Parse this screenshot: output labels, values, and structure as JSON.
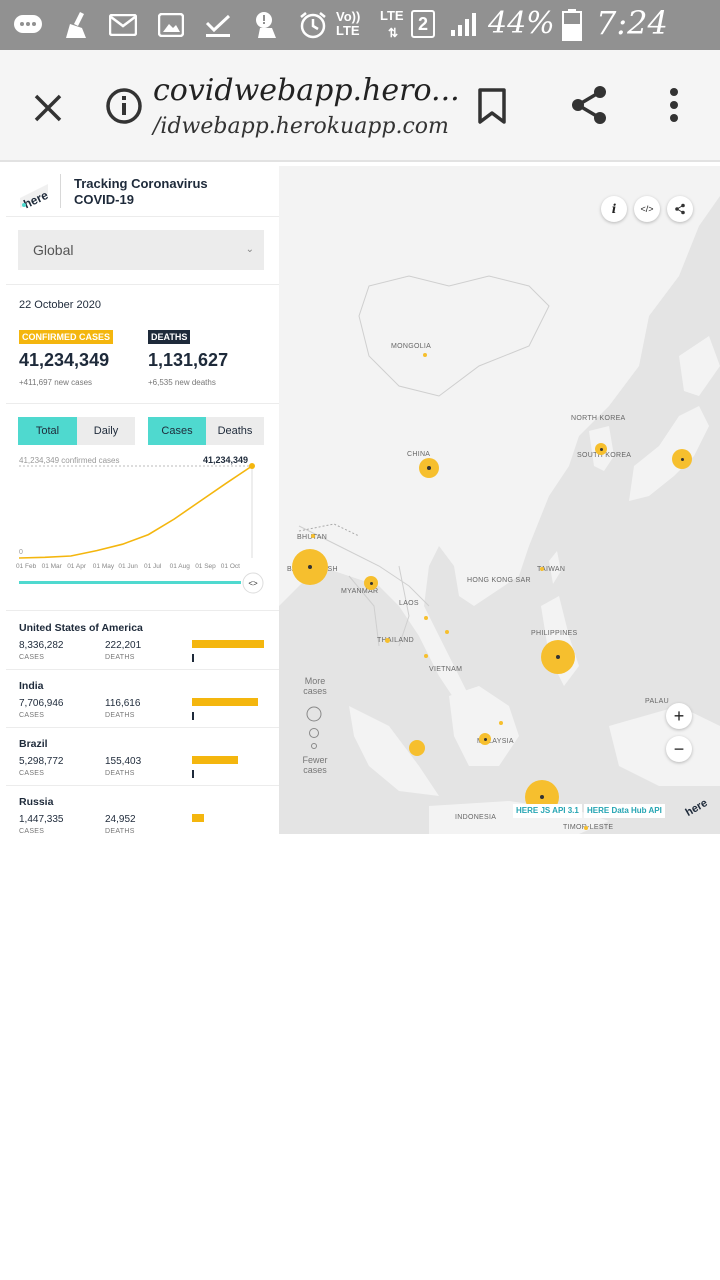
{
  "status_bar": {
    "network": "Vo)) LTE",
    "lte_label": "LTE",
    "sim": "2",
    "battery": "44%",
    "time": "7:24 pm"
  },
  "browser": {
    "title": "covidwebapp.hero...",
    "url": "/idwebapp.herokuapp.com"
  },
  "app": {
    "title": "Tracking Coronavirus COVID-19",
    "logo_text": "here",
    "region_select": "Global",
    "date": "22 October 2020",
    "confirmed": {
      "label": "CONFIRMED CASES",
      "value": "41,234,349",
      "new": "+411,697 new cases"
    },
    "deaths": {
      "label": "DEATHS",
      "value": "1,131,627",
      "new": "+6,535 new deaths"
    },
    "toggles": {
      "total": "Total",
      "daily": "Daily",
      "cases": "Cases",
      "deaths": "Deaths"
    },
    "countries": [
      {
        "name": "United States of America",
        "cases": "8,336,282",
        "deaths": "222,201",
        "cases_label": "CASES",
        "deaths_label": "DEATHS",
        "bar_fraction": 1.0
      },
      {
        "name": "India",
        "cases": "7,706,946",
        "deaths": "116,616",
        "cases_label": "CASES",
        "deaths_label": "DEATHS",
        "bar_fraction": 0.92
      },
      {
        "name": "Brazil",
        "cases": "5,298,772",
        "deaths": "155,403",
        "cases_label": "CASES",
        "deaths_label": "DEATHS",
        "bar_fraction": 0.64
      },
      {
        "name": "Russia",
        "cases": "1,447,335",
        "deaths": "24,952",
        "cases_label": "CASES",
        "deaths_label": "DEATHS",
        "bar_fraction": 0.17
      }
    ]
  },
  "chart_data": {
    "type": "line",
    "series": [
      {
        "values": [
          0,
          300000,
          900000,
          3300000,
          6200000,
          10500000,
          17500000,
          25500000,
          33500000,
          41234349
        ]
      }
    ],
    "categories": [
      "01 Feb",
      "01 Mar",
      "01 Apr",
      "01 May",
      "01 Jun",
      "01 Jul",
      "01 Aug",
      "01 Sep",
      "01 Oct",
      "22 Oct"
    ],
    "tick_labels": [
      "01 Feb",
      "01 Mar",
      "01 Apr",
      "01 May",
      "01 Jun",
      "01 Jul",
      "01 Aug",
      "01 Sep",
      "01 Oct"
    ],
    "max_label_left": "41,234,349 confirmed cases",
    "max_label_right": "41,234,349",
    "zero_label": "0",
    "ylim": [
      0,
      41234349
    ],
    "line_color": "#f4b60e",
    "slider_color": "#4fd9cf",
    "slider_handle": "<>"
  },
  "map": {
    "labels": [
      "MONGOLIA",
      "NORTH KOREA",
      "SOUTH KOREA",
      "CHINA",
      "BHUTAN",
      "HONG KONG SAR",
      "TAIWAN",
      "MYANMAR",
      "LAOS",
      "THAILAND",
      "VIETNAM",
      "PHILIPPINES",
      "PALAU",
      "MALAYSIA",
      "INDONESIA",
      "TIMOR-LESTE",
      "BANGLADESH"
    ],
    "legend_more": "More cases",
    "legend_fewer": "Fewer cases",
    "api_js": "HERE JS API 3.1",
    "api_hub": "HERE Data Hub API",
    "watermark": "here",
    "bubble_color": "#f6bf2e"
  }
}
